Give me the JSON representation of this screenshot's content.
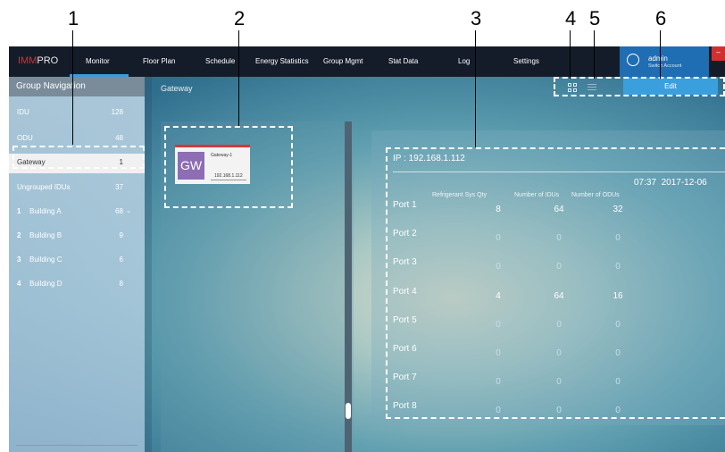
{
  "callouts": [
    "1",
    "2",
    "3",
    "4",
    "5",
    "6"
  ],
  "app": {
    "logo_a": "IMM",
    "logo_b": "PRO",
    "nav": [
      "Monitor",
      "Floor Plan",
      "Schedule",
      "Energy Statistics",
      "Group Mgmt",
      "Stat Data",
      "Log",
      "Settings"
    ],
    "active_nav": "Monitor",
    "user": {
      "name": "admin",
      "switch_label": "Switch Account"
    },
    "close_label": "–"
  },
  "sidebar": {
    "title": "Group Navigation",
    "rows": [
      {
        "label": "IDU",
        "count": "128"
      },
      {
        "label": "ODU",
        "count": "48"
      },
      {
        "label": "Gateway",
        "count": "1",
        "selected": true
      },
      {
        "label": "Ungrouped IDUs",
        "count": "37"
      }
    ],
    "buildings": [
      {
        "index": "1",
        "label": "Building A",
        "count": "68"
      },
      {
        "index": "2",
        "label": "Building B",
        "count": "9"
      },
      {
        "index": "3",
        "label": "Building C",
        "count": "6"
      },
      {
        "index": "4",
        "label": "Building D",
        "count": "8"
      }
    ]
  },
  "breadcrumb": "Gateway",
  "toolbar": {
    "edit_label": "Edit"
  },
  "gateway_card": {
    "badge": "GW",
    "name": "Gateway-1",
    "ip": "192.168.1.112"
  },
  "details": {
    "ip_label": "IP : 192.168.1.112",
    "time": "07:37",
    "date": "2017-12-06",
    "headers": [
      "Refrigerant Sys Qty",
      "Number of IDUs",
      "Number of ODUs"
    ],
    "ports": [
      {
        "name": "Port 1",
        "values": [
          "8",
          "64",
          "32"
        ]
      },
      {
        "name": "Port 2",
        "values": [
          "0",
          "0",
          "0"
        ]
      },
      {
        "name": "Port 3",
        "values": [
          "0",
          "0",
          "0"
        ]
      },
      {
        "name": "Port 4",
        "values": [
          "4",
          "64",
          "16"
        ]
      },
      {
        "name": "Port 5",
        "values": [
          "0",
          "0",
          "0"
        ]
      },
      {
        "name": "Port 6",
        "values": [
          "0",
          "0",
          "0"
        ]
      },
      {
        "name": "Port 7",
        "values": [
          "0",
          "0",
          "0"
        ]
      },
      {
        "name": "Port 8",
        "values": [
          "0",
          "0",
          "0"
        ]
      }
    ]
  },
  "colors": {
    "nonzero_value": "#ffffff",
    "zero_value": "#c8dde6"
  }
}
